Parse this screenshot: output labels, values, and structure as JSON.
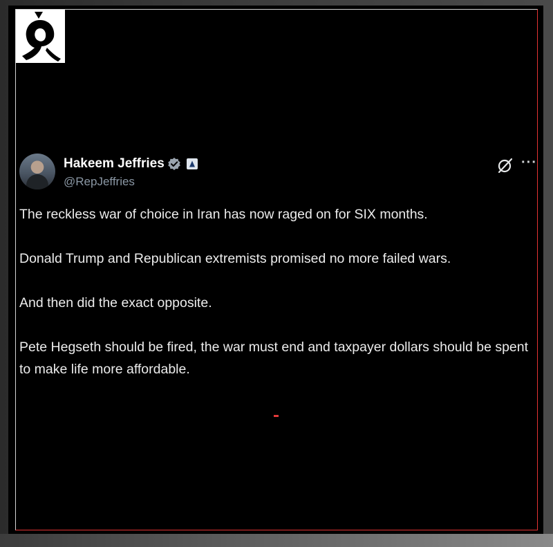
{
  "tweet": {
    "display_name": "Hakeem Jeffries",
    "handle": "@RepJeffries",
    "paragraphs": [
      "The reckless war of choice in Iran has now raged on for SIX months.",
      "Donald Trump and Republican extremists promised no more failed wars.",
      "And then did the exact opposite.",
      "Pete Hegseth should be fired, the war must end and taxpayer dollars should be spent to make life more affordable."
    ],
    "more_label": "···"
  },
  "icons": {
    "verified": "verified-badge-icon",
    "affiliation": "affiliation-badge-icon",
    "grok": "grok-icon",
    "more": "more-icon",
    "logo": "channel-logo-icon"
  },
  "colors": {
    "background": "#000000",
    "text": "#e7e9ea",
    "handle": "#8b98a5",
    "frame_accent": "#e63333"
  }
}
